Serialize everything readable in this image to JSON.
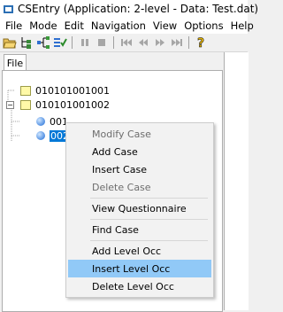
{
  "window": {
    "title": "CSEntry (Application: 2-level - Data: Test.dat)"
  },
  "menu": [
    "File",
    "Mode",
    "Edit",
    "Navigation",
    "View",
    "Options",
    "Help"
  ],
  "toolbar": {
    "buttons": [
      "open-icon",
      "add-node-icon",
      "tree-icon",
      "check-icon",
      "pause-icon",
      "stop-icon",
      "first-icon",
      "prev-icon",
      "next-icon",
      "last-icon",
      "help-icon"
    ]
  },
  "tabs": {
    "file": "File"
  },
  "tree": {
    "nodes": [
      {
        "label": "010101001001",
        "type": "folder"
      },
      {
        "label": "010101001002",
        "type": "folder",
        "expanded": true
      },
      {
        "label": "001",
        "type": "case"
      },
      {
        "label": "002",
        "type": "case",
        "selected": true
      }
    ]
  },
  "context_menu": {
    "items": [
      {
        "label": "Modify Case",
        "disabled": true
      },
      {
        "label": "Add Case",
        "disabled": false
      },
      {
        "label": "Insert Case",
        "disabled": false
      },
      {
        "label": "Delete Case",
        "disabled": true
      },
      {
        "label": "View Questionnaire",
        "disabled": false
      },
      {
        "label": "Find Case",
        "disabled": false
      },
      {
        "label": "Add Level Occ",
        "disabled": false
      },
      {
        "label": "Insert Level Occ",
        "disabled": false,
        "highlighted": true
      },
      {
        "label": "Delete Level Occ",
        "disabled": false
      }
    ]
  },
  "colors": {
    "selection": "#0078d7",
    "highlight": "#91c9f7",
    "folder": "#fff9a8"
  }
}
